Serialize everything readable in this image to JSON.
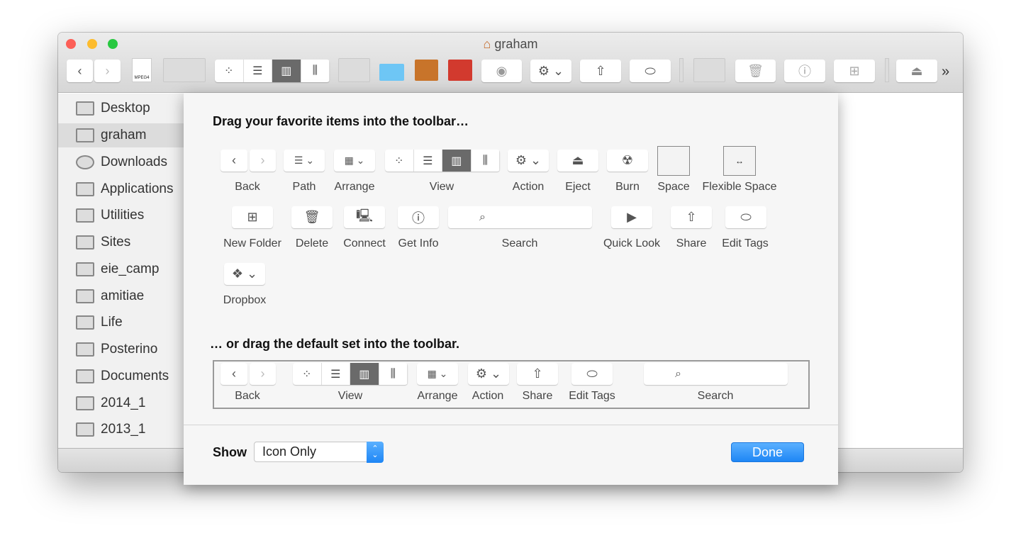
{
  "window": {
    "title": "graham"
  },
  "toolbar": {
    "overflow": "»",
    "mpeg_label": "MPEG4"
  },
  "sidebar": {
    "items": [
      {
        "label": "Desktop"
      },
      {
        "label": "graham",
        "selected": true
      },
      {
        "label": "Downloads"
      },
      {
        "label": "Applications"
      },
      {
        "label": "Utilities"
      },
      {
        "label": "Sites"
      },
      {
        "label": "eie_camp"
      },
      {
        "label": "amitiae"
      },
      {
        "label": "Life"
      },
      {
        "label": "Posterino"
      },
      {
        "label": "Documents"
      },
      {
        "label": "2014_1"
      },
      {
        "label": "2013_1"
      }
    ]
  },
  "sheet": {
    "heading1": "Drag your favorite items into the toolbar…",
    "items": {
      "back": "Back",
      "path": "Path",
      "arrange": "Arrange",
      "view": "View",
      "action": "Action",
      "eject": "Eject",
      "burn": "Burn",
      "space": "Space",
      "flexible_space": "Flexible Space",
      "new_folder": "New Folder",
      "delete": "Delete",
      "connect": "Connect",
      "get_info": "Get Info",
      "search": "Search",
      "quick_look": "Quick Look",
      "share": "Share",
      "edit_tags": "Edit Tags",
      "dropbox": "Dropbox"
    },
    "heading2": "… or drag the default set into the toolbar.",
    "default_set": {
      "back": "Back",
      "view": "View",
      "arrange": "Arrange",
      "action": "Action",
      "share": "Share",
      "edit_tags": "Edit Tags",
      "search": "Search"
    },
    "show_label": "Show",
    "show_value": "Icon Only",
    "done": "Done"
  },
  "colors": {
    "accent": "#1e86f5",
    "selected_segment": "#6a6a6a"
  }
}
